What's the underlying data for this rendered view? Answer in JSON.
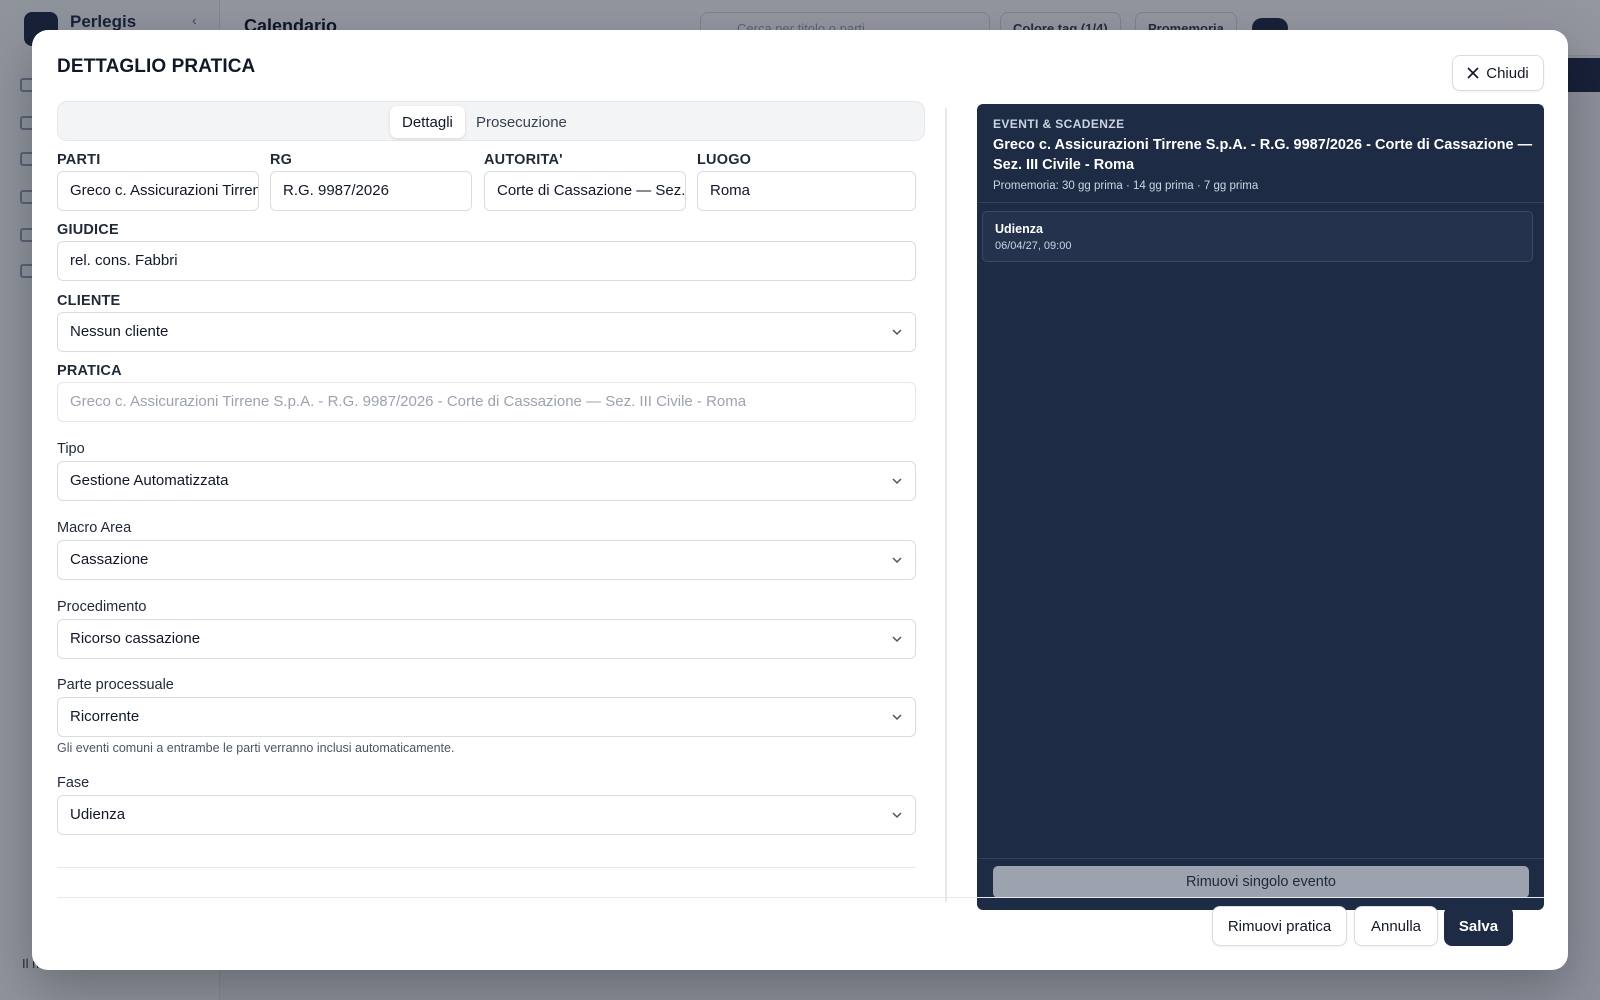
{
  "background": {
    "brand": "Perlegis",
    "page_title": "Calendario",
    "search_placeholder": "Cerca per titolo o parti...",
    "chip_color_label": "Colore tag",
    "chip_color_value": "(1/4)",
    "chip_reminder_label": "Promemoria",
    "user_label": "Il mio studio"
  },
  "modal": {
    "title": "DETTAGLIO PRATICA",
    "close_label": "Chiudi",
    "tabs": [
      "Dettagli",
      "Prosecuzione"
    ],
    "active_tab": "Dettagli"
  },
  "form": {
    "parti": {
      "label": "PARTI",
      "value": "Greco c. Assicurazioni Tirrene S.p.A."
    },
    "rg": {
      "label": "RG",
      "value": "R.G. 9987/2026"
    },
    "autorita": {
      "label": "AUTORITA'",
      "value": "Corte di Cassazione — Sez. III Civile"
    },
    "luogo": {
      "label": "LUOGO",
      "value": "Roma"
    },
    "giudice": {
      "label": "GIUDICE",
      "value": "rel. cons. Fabbri"
    },
    "cliente": {
      "label": "CLIENTE",
      "value": "Nessun cliente"
    },
    "pratica": {
      "label": "PRATICA",
      "value": "Greco c. Assicurazioni Tirrene S.p.A. - R.G. 9987/2026 - Corte di Cassazione — Sez. III Civile - Roma"
    },
    "tipo": {
      "label": "Tipo",
      "value": "Gestione Automatizzata"
    },
    "macro_area": {
      "label": "Macro Area",
      "value": "Cassazione"
    },
    "procedimento": {
      "label": "Procedimento",
      "value": "Ricorso cassazione"
    },
    "parte_processuale": {
      "label": "Parte processuale",
      "value": "Ricorrente",
      "hint": "Gli eventi comuni a entrambe le parti verranno inclusi automaticamente."
    },
    "fase": {
      "label": "Fase",
      "value": "Udienza"
    }
  },
  "events_panel": {
    "kicker": "EVENTI & SCADENZE",
    "title": "Greco c. Assicurazioni Tirrene S.p.A. - R.G. 9987/2026 - Corte di Cassazione — Sez. III Civile - Roma",
    "reminder": "Promemoria: 30 gg prima · 14 gg prima · 7 gg prima",
    "items": [
      {
        "name": "Udienza",
        "date": "06/04/27, 09:00"
      }
    ],
    "remove_event_label": "Rimuovi singolo evento"
  },
  "footer": {
    "remove_label": "Rimuovi pratica",
    "cancel_label": "Annulla",
    "save_label": "Salva"
  },
  "colors": {
    "accent": "#1e2b44",
    "panel_bg": "#1e2b44",
    "border": "#d9dce1"
  }
}
